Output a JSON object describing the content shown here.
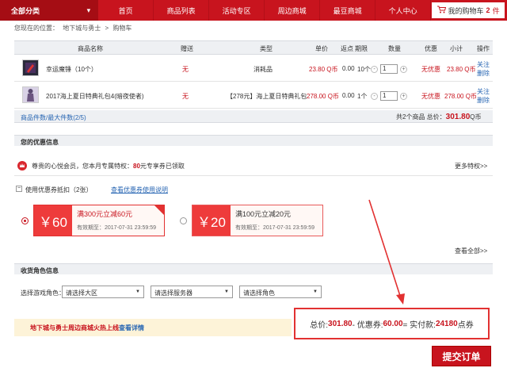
{
  "nav": {
    "all": "全部分类",
    "items": [
      "首页",
      "商品列表",
      "活动专区",
      "周边商城",
      "最豆商城",
      "个人中心"
    ],
    "cart_label": "我的购物车",
    "cart_count": "2",
    "cart_unit": "件"
  },
  "breadcrumb": [
    "您现在的位置：",
    "地下城与勇士",
    ">",
    "购物车"
  ],
  "table": {
    "headers": [
      "商品名称",
      "赠送",
      "类型",
      "单价",
      "返点",
      "期限",
      "数量",
      "优惠",
      "小计",
      "操作"
    ],
    "rows": [
      {
        "name": "幸运魔锤（10个）",
        "gift": "无",
        "type": "消耗品",
        "price": "23.80 Q币",
        "rebate": "0.00",
        "term": "10个",
        "qty": "1",
        "discount": "无优惠",
        "subtotal": "23.80 Q币",
        "op1": "关注",
        "op2": "删除"
      },
      {
        "name": "2017海上夏日特典礼包4(暗夜使者)",
        "gift": "无",
        "type": "【278元】海上夏日特典礼包",
        "price": "278.00 Q币",
        "rebate": "0.00",
        "term": "1个",
        "qty": "1",
        "discount": "无优惠",
        "subtotal": "278.00 Q币",
        "op1": "关注",
        "op2": "删除"
      }
    ]
  },
  "summary": {
    "left": "商品件数/最大件数(2/5)",
    "right_prefix": "共2个商品 总价：",
    "right_value": "301.80",
    "right_unit": "Q币"
  },
  "offers": {
    "title": "您的优惠信息",
    "member_text_a": "尊贵的心悦会员，您本月专属特权：",
    "member_value": "80",
    "member_text_b": "元专享券已领取",
    "more_priv": "更多特权>>",
    "use_coupon": "使用优惠券抵扣",
    "coupon_count": "（2张）",
    "coupon_help": "查看优惠券使用说明",
    "coupons": [
      {
        "amount": "￥60",
        "title": "满300元立减60元",
        "expiry": "有效期至：2017-07-31 23:59:59"
      },
      {
        "amount": "￥20",
        "title": "满100元立减20元",
        "expiry": "有效期至：2017-07-31 23:59:59"
      }
    ],
    "view_all": "查看全部>>"
  },
  "role": {
    "title": "收货角色信息",
    "label": "选择游戏角色：",
    "selects": [
      "请选择大区",
      "请选择服务器",
      "请选择角色"
    ]
  },
  "promo": {
    "text": "地下城与勇士周边商城火热上线",
    "link": "查看详情"
  },
  "total": {
    "label_a": "总价:",
    "value_a": "301.80",
    "label_b": "- 优惠券:",
    "value_b": "60.00",
    "label_c": "= 实付款:",
    "value_c": "24180",
    "unit": "点券"
  },
  "submit": "提交订单",
  "colors": {
    "brand": "#c8141e",
    "link": "#2866b3"
  }
}
